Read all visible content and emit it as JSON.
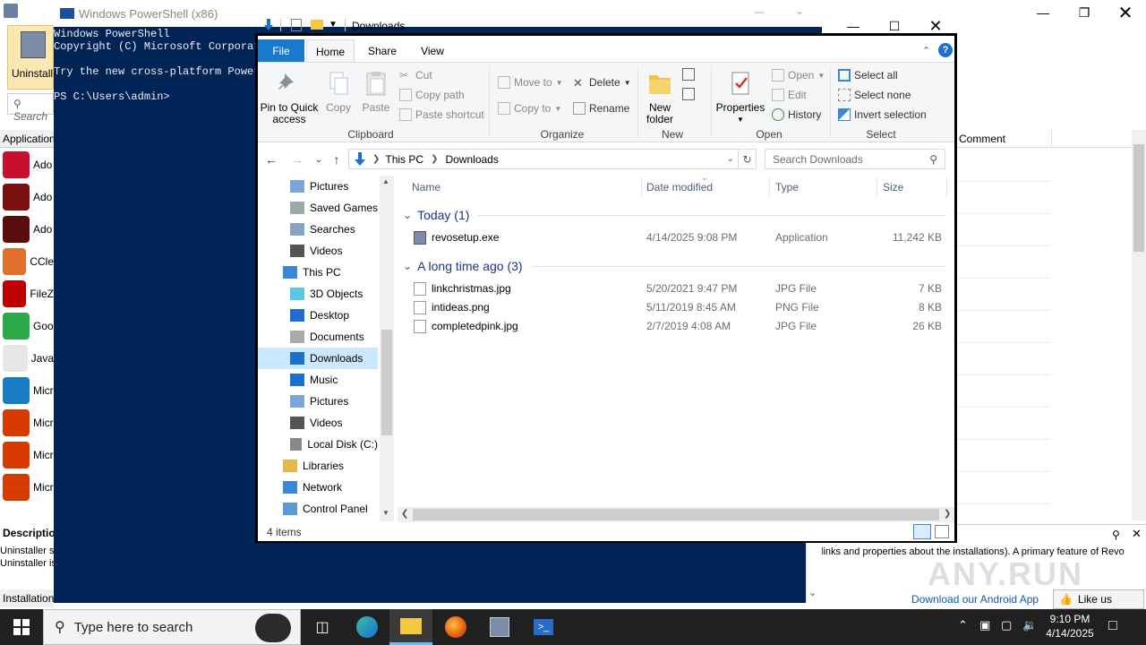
{
  "revo": {
    "search_placeholder": "Search",
    "uninstall_label": "Uninstall",
    "apps_header": "Application",
    "apps": [
      {
        "name": "Ado",
        "color": "#c8102e"
      },
      {
        "name": "Ado",
        "color": "#7a1010"
      },
      {
        "name": "Ado",
        "color": "#5a0b0b"
      },
      {
        "name": "CCle",
        "color": "#e0702c"
      },
      {
        "name": "FileZ",
        "color": "#bf0000"
      },
      {
        "name": "Goo",
        "color": "#2ea94a"
      },
      {
        "name": "Java",
        "color": "#e7e7e7"
      },
      {
        "name": "Micr",
        "color": "#1a7ec7"
      },
      {
        "name": "Micr",
        "color": "#d83b01"
      },
      {
        "name": "Micr",
        "color": "#d83b01"
      },
      {
        "name": "Micr",
        "color": "#d83b01"
      }
    ],
    "desc_header": "Description",
    "desc_line1": "Uninstaller s",
    "desc_line2": "Uninstaller is",
    "status": "Installation",
    "comment_header": "Comment",
    "bottom_text": "links and properties about the installations). A primary feature of Revo",
    "android_link": "Download our Android App",
    "like_us": "Like us",
    "watermark": "ANY.RUN"
  },
  "powershell": {
    "title": "Windows PowerShell (x86)",
    "lines": [
      "Windows PowerShell",
      "Copyright (C) Microsoft Corporat",
      "",
      "Try the new cross-platform Power",
      "",
      "PS C:\\Users\\admin>"
    ]
  },
  "explorer": {
    "title": "Downloads",
    "tabs": {
      "file": "File",
      "home": "Home",
      "share": "Share",
      "view": "View"
    },
    "ribbon": {
      "clipboard": {
        "label": "Clipboard",
        "pin": "Pin to Quick access",
        "copy": "Copy",
        "paste": "Paste",
        "cut": "Cut",
        "copy_path": "Copy path",
        "paste_shortcut": "Paste shortcut"
      },
      "organize": {
        "label": "Organize",
        "move_to": "Move to",
        "copy_to": "Copy to",
        "delete": "Delete",
        "rename": "Rename"
      },
      "new": {
        "label": "New",
        "new_folder": "New folder"
      },
      "open": {
        "label": "Open",
        "properties": "Properties",
        "open": "Open",
        "edit": "Edit",
        "history": "History"
      },
      "select": {
        "label": "Select",
        "select_all": "Select all",
        "select_none": "Select none",
        "invert": "Invert selection"
      }
    },
    "address": {
      "crumb1": "This PC",
      "crumb2": "Downloads"
    },
    "search_placeholder": "Search Downloads",
    "nav": [
      {
        "label": "Pictures",
        "indent": 1,
        "selected": false
      },
      {
        "label": "Saved Games",
        "indent": 1,
        "selected": false
      },
      {
        "label": "Searches",
        "indent": 1,
        "selected": false
      },
      {
        "label": "Videos",
        "indent": 1,
        "selected": false
      },
      {
        "label": "This PC",
        "indent": 0,
        "selected": false
      },
      {
        "label": "3D Objects",
        "indent": 1,
        "selected": false
      },
      {
        "label": "Desktop",
        "indent": 1,
        "selected": false
      },
      {
        "label": "Documents",
        "indent": 1,
        "selected": false
      },
      {
        "label": "Downloads",
        "indent": 1,
        "selected": true
      },
      {
        "label": "Music",
        "indent": 1,
        "selected": false
      },
      {
        "label": "Pictures",
        "indent": 1,
        "selected": false
      },
      {
        "label": "Videos",
        "indent": 1,
        "selected": false
      },
      {
        "label": "Local Disk (C:)",
        "indent": 1,
        "selected": false
      },
      {
        "label": "Libraries",
        "indent": 0,
        "selected": false
      },
      {
        "label": "Network",
        "indent": 0,
        "selected": false
      },
      {
        "label": "Control Panel",
        "indent": 0,
        "selected": false
      }
    ],
    "columns": {
      "name": "Name",
      "date": "Date modified",
      "type": "Type",
      "size": "Size"
    },
    "groups": [
      {
        "label": "Today (1)",
        "files": [
          {
            "name": "revosetup.exe",
            "date": "4/14/2025 9:08 PM",
            "type": "Application",
            "size": "11,242 KB",
            "icon": "exe-icon"
          }
        ]
      },
      {
        "label": "A long time ago (3)",
        "files": [
          {
            "name": "linkchristmas.jpg",
            "date": "5/20/2021 9:47 PM",
            "type": "JPG File",
            "size": "7 KB",
            "icon": "image-file-icon"
          },
          {
            "name": "intideas.png",
            "date": "5/11/2019 8:45 AM",
            "type": "PNG File",
            "size": "8 KB",
            "icon": "image-file-icon"
          },
          {
            "name": "completedpink.jpg",
            "date": "2/7/2019 4:08 AM",
            "type": "JPG File",
            "size": "26 KB",
            "icon": "image-file-icon"
          }
        ]
      }
    ],
    "status": "4 items"
  },
  "taskbar": {
    "search_placeholder": "Type here to search",
    "time": "9:10 PM",
    "date": "4/14/2025",
    "apps": [
      "task-view",
      "edge",
      "file-explorer",
      "firefox",
      "revo-uninstaller",
      "powershell"
    ]
  },
  "colors": {
    "ps_bg": "#012456",
    "file_tab": "#1979ca",
    "selected": "#cce8ff",
    "group_text": "#1e3287",
    "taskbar": "#202020"
  }
}
